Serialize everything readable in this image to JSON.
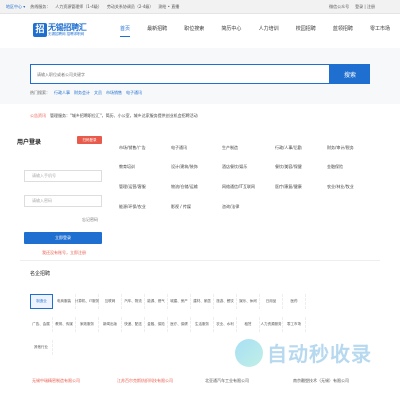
{
  "topbar": {
    "location": "地区中心 ▾",
    "links": [
      "热线服务：",
      "人力资源管理师（1-4级）",
      "劳动关系协调员（2-4级）",
      "测绘 • 直播"
    ],
    "right": [
      "微信公众号",
      "登录 | 注册"
    ]
  },
  "brand": {
    "badge": "招",
    "name": "无锡招聘汇",
    "sub": "无锡招聘网 招聘求职网"
  },
  "nav": {
    "items": [
      "首页",
      "最新招聘",
      "职位搜索",
      "简历中心",
      "人力培训",
      "校园招聘",
      "蓝领招聘",
      "零工市场"
    ]
  },
  "search": {
    "placeholder": "请输入职位或者公司关键字",
    "button": "搜索",
    "hot_label": "热门搜索：",
    "hot": [
      "行政人事",
      "财务会计",
      "文员",
      "市场销售",
      "电子通讯"
    ]
  },
  "notice": {
    "tag": "公告资讯",
    "text": "管理服务：\"城乡招聘职位汇\"，简历、小公室，城乡达家服务提供创业机会招聘活动"
  },
  "login": {
    "title": "用户登录",
    "qr": "扫码登录",
    "username_placeholder": "请输入手机号",
    "password_placeholder": "请输入密码",
    "forgot": "忘记密码",
    "submit": "立即登录",
    "register": "我还没有账号，立即注册"
  },
  "categories": [
    [
      "市场/销售/广告",
      "电子通讯",
      "生产制造",
      "行政/人事/后勤",
      "财务/审计/税务"
    ],
    [
      "教育培训",
      "设计/建筑/装饰",
      "酒店餐饮/娱乐",
      "餐饮/美容/保健",
      "金融保险"
    ],
    [
      "管理/运营/客服",
      "物流/仓储/运输",
      "网络通信/IT互联网",
      "医疗/康复/健康",
      "农业/林业/牧业"
    ],
    [
      "能源/环保/农业",
      "影视 / 传媒",
      "咨询/法律"
    ]
  ],
  "famous": {
    "title": "名企招聘",
    "rows": [
      [
        "制造业",
        "电商服装",
        "计算机、IT服务",
        "互联网",
        "汽车、物流",
        "能源、燃气",
        "城建、房产",
        "建材、家居",
        "旅游、餐饮",
        "娱乐、休闲",
        "日用品",
        "医药"
      ],
      [
        "广告、会展",
        "教育、传媒",
        "家政服务",
        "新闻出版",
        "快递、配送",
        "金融、保险",
        "医疗、保健",
        "生活服务",
        "农业、水利",
        "租赁",
        "人力资源服务",
        "零工市场"
      ],
      [
        "其他行业"
      ]
    ]
  },
  "companies": [
    "无锡中瑞精密制造有限公司",
    "江苏百尔克斯纺织科技有限公司",
    "北亚通汽车工业有限公司",
    "南京雕塑技术（无锡）有限公司"
  ],
  "watermark": "自动秒收录"
}
